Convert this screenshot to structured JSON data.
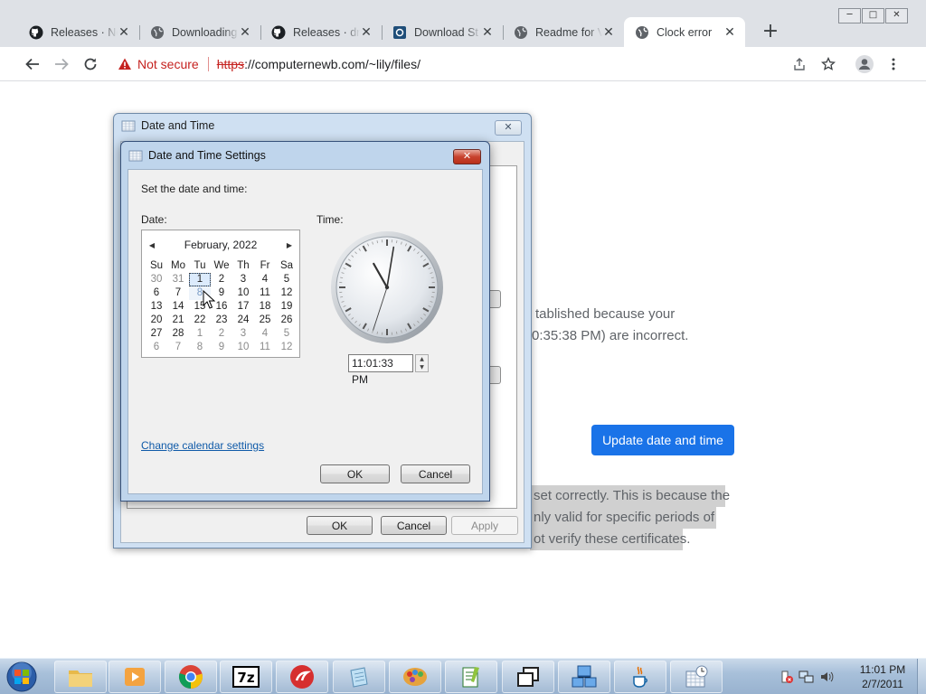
{
  "window_controls": {
    "minimize": "─",
    "maximize": "□",
    "close": "✕"
  },
  "tabs": [
    {
      "title": "Releases · Ne",
      "icon": "github-icon",
      "active": false
    },
    {
      "title": "Downloading",
      "icon": "globe-icon",
      "active": false
    },
    {
      "title": "Releases · dr",
      "icon": "github-icon",
      "active": false
    },
    {
      "title": "Download St",
      "icon": "app-icon",
      "active": false
    },
    {
      "title": "Readme for V",
      "icon": "globe-icon",
      "active": false
    },
    {
      "title": "Clock error",
      "icon": "globe-icon",
      "active": true
    }
  ],
  "tab_close_glyph": "✕",
  "new_tab_glyph": "+",
  "address_bar": {
    "security_label": "Not secure",
    "url_scheme": "https",
    "url_rest": "://computernewb.com/~lily/files/"
  },
  "page": {
    "error_line1": "tablished because your",
    "error_line2": "0:35:38 PM) are incorrect.",
    "update_button": "Update date and time",
    "selected_line1": "set correctly. This is because the",
    "selected_line2": "nly valid for specific periods of",
    "selected_line3": "ot verify these certificates."
  },
  "outer_dialog": {
    "title": "Date and Time",
    "close_glyph": "✕",
    "ok": "OK",
    "cancel": "Cancel",
    "apply": "Apply"
  },
  "settings_dialog": {
    "title": "Date and Time Settings",
    "close_glyph": "✕",
    "instruction": "Set the date and time:",
    "date_label": "Date:",
    "time_label": "Time:",
    "month_year": "February, 2022",
    "prev_arrow": "◀",
    "next_arrow": "▶",
    "weekdays": [
      "Su",
      "Mo",
      "Tu",
      "We",
      "Th",
      "Fr",
      "Sa"
    ],
    "days": [
      [
        "30",
        "31",
        "1",
        "2",
        "3",
        "4",
        "5"
      ],
      [
        "6",
        "7",
        "8",
        "9",
        "10",
        "11",
        "12"
      ],
      [
        "13",
        "14",
        "15",
        "16",
        "17",
        "18",
        "19"
      ],
      [
        "20",
        "21",
        "22",
        "23",
        "24",
        "25",
        "26"
      ],
      [
        "27",
        "28",
        "1",
        "2",
        "3",
        "4",
        "5"
      ],
      [
        "6",
        "7",
        "8",
        "9",
        "10",
        "11",
        "12"
      ]
    ],
    "selected_day": "1",
    "hover_day": "8",
    "time_value": "11:01:33 PM",
    "clock_time": {
      "hour": 11,
      "minute": 1,
      "second": 33
    },
    "spin_up": "▲",
    "spin_down": "▼",
    "calendar_link": "Change calendar settings",
    "ok": "OK",
    "cancel": "Cancel"
  },
  "taskbar": {
    "apps": [
      {
        "name": "file-explorer-icon"
      },
      {
        "name": "media-player-icon"
      },
      {
        "name": "chrome-icon"
      },
      {
        "name": "7zip-icon"
      },
      {
        "name": "red-app-icon"
      },
      {
        "name": "notepad-icon"
      },
      {
        "name": "paint-icon"
      },
      {
        "name": "notepadpp-icon"
      },
      {
        "name": "window-switch-icon"
      },
      {
        "name": "network-tool-icon"
      },
      {
        "name": "java-icon"
      },
      {
        "name": "date-time-icon"
      }
    ],
    "time": "11:01 PM",
    "date": "2/7/2011"
  },
  "colors": {
    "accent_blue": "#1a73e8",
    "warning_red": "#c5221f",
    "link_blue": "#0f5aa8"
  }
}
